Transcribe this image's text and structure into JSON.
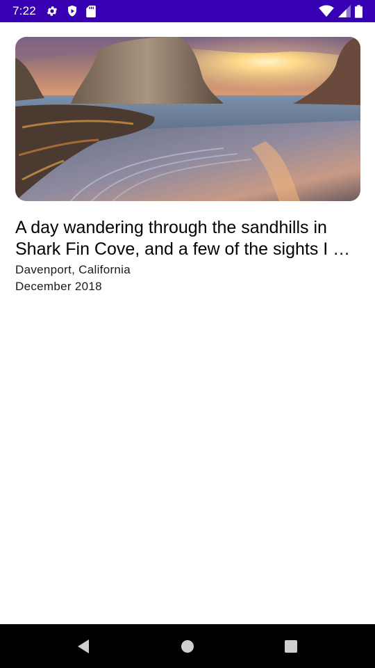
{
  "status_bar": {
    "time": "7:22",
    "background_color": "#3700b3",
    "left_icons": [
      "gear-icon",
      "play-protect-icon",
      "sd-card-icon"
    ],
    "right_icons": [
      "wifi-icon",
      "cell-signal-icon",
      "battery-icon"
    ]
  },
  "card": {
    "image_subject": "sea stack at sunset over beach",
    "title": "A day wandering through the sandhills in Shark Fin Cove, and a few of the sights I …",
    "location": "Davenport, California",
    "date": "December 2018"
  },
  "nav_bar": {
    "background_color": "#000000",
    "buttons": [
      "back-icon",
      "home-icon",
      "recents-icon"
    ]
  }
}
